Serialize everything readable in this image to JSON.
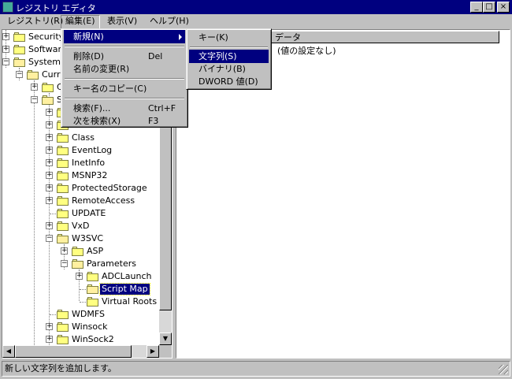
{
  "window": {
    "title": "レジストリ エディタ",
    "buttons": {
      "minimize": "_",
      "maximize": "□",
      "close": "×"
    }
  },
  "menubar": {
    "items": [
      {
        "label": "レジストリ(R)"
      },
      {
        "label": "編集(E)"
      },
      {
        "label": "表示(V)"
      },
      {
        "label": "ヘルプ(H)"
      }
    ]
  },
  "edit_menu": {
    "new": "新規(N)",
    "delete": "削除(D)",
    "delete_shortcut": "Del",
    "rename": "名前の変更(R)",
    "copy_key_name": "キー名のコピー(C)",
    "find": "検索(F)...",
    "find_shortcut": "Ctrl+F",
    "find_next": "次を検索(X)",
    "find_next_shortcut": "F3"
  },
  "new_submenu": {
    "key": "キー(K)",
    "string": "文字列(S)",
    "binary": "バイナリ(B)",
    "dword": "DWORD 値(D)"
  },
  "tree": {
    "nodes": [
      {
        "label": "Security"
      },
      {
        "label": "Software"
      },
      {
        "label": "System"
      },
      {
        "label": "Curr"
      },
      {
        "label": "C"
      },
      {
        "label": "S"
      },
      {
        "label": ""
      },
      {
        "label": ""
      },
      {
        "label": "Class"
      },
      {
        "label": "EventLog"
      },
      {
        "label": "InetInfo"
      },
      {
        "label": "MSNP32"
      },
      {
        "label": "ProtectedStorage"
      },
      {
        "label": "RemoteAccess"
      },
      {
        "label": "UPDATE"
      },
      {
        "label": "VxD"
      },
      {
        "label": "W3SVC"
      },
      {
        "label": "ASP"
      },
      {
        "label": "Parameters"
      },
      {
        "label": "ADCLaunch"
      },
      {
        "label": "Script Map"
      },
      {
        "label": "Virtual Roots"
      },
      {
        "label": "WDMFS"
      },
      {
        "label": "Winsock"
      },
      {
        "label": "WinSock2"
      }
    ]
  },
  "list": {
    "col_data": "データ",
    "rows": [
      {
        "data": "(値の設定なし)"
      }
    ]
  },
  "status": {
    "text": "新しい文字列を追加します。"
  },
  "colors": {
    "titlebar": "#00007f",
    "face": "#c0c0c0",
    "highlight": "#00007f"
  }
}
